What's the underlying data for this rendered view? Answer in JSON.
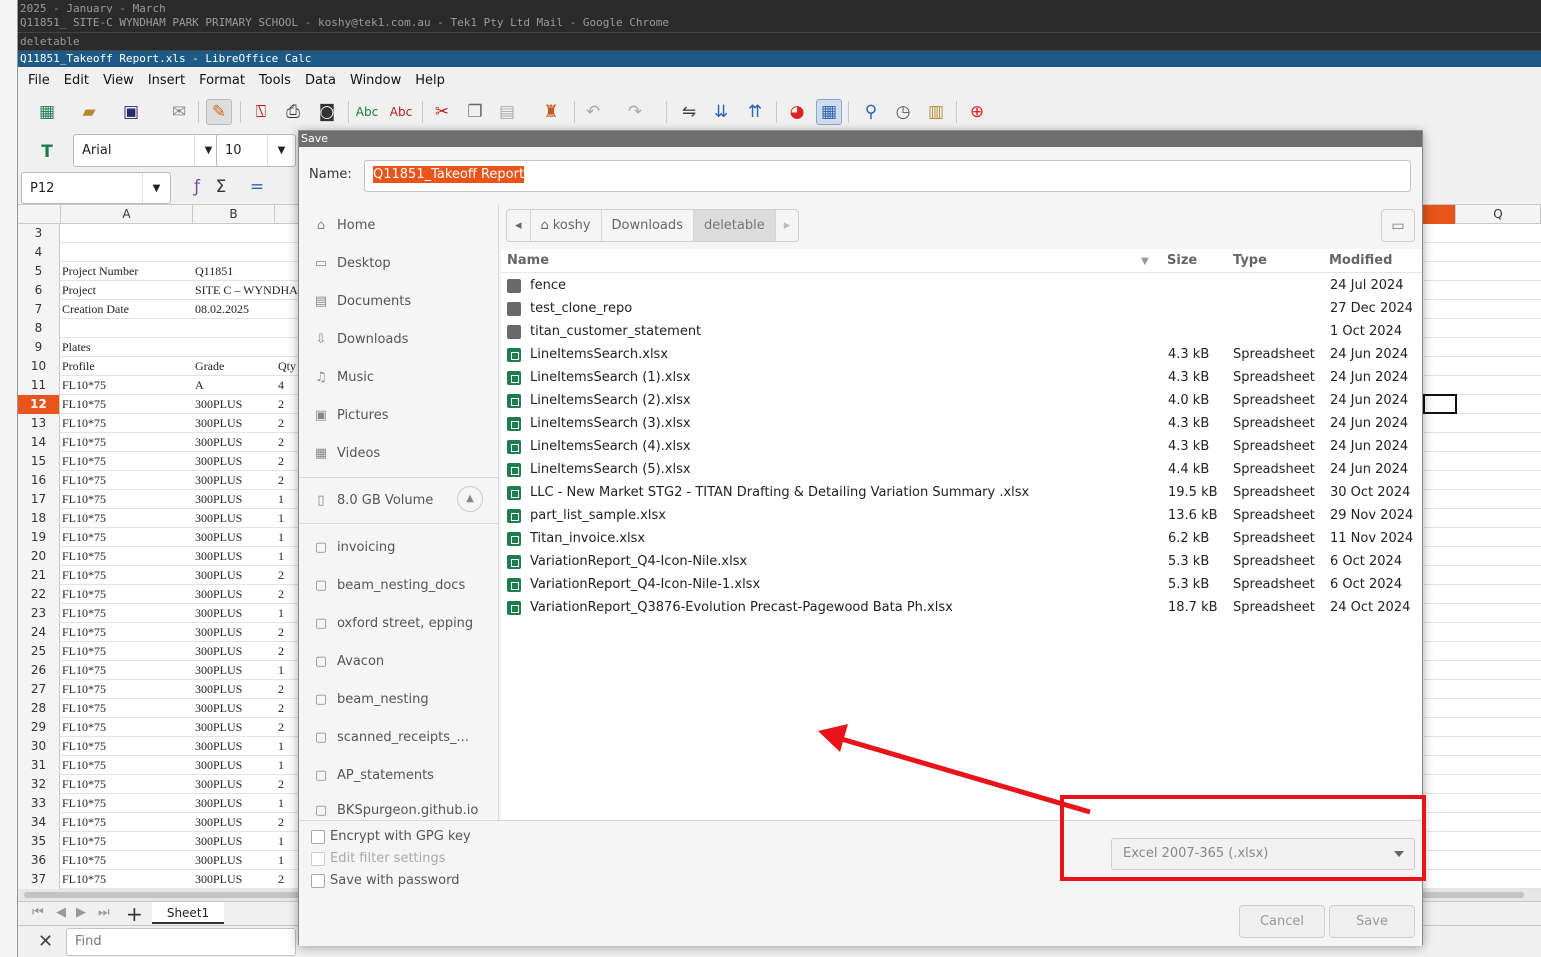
{
  "top_bars": [
    "2025 - January - March",
    "Q11851_ SITE-C WYNDHAM PARK PRIMARY SCHOOL - koshy@tek1.com.au - Tek1 Pty Ltd Mail - Google Chrome",
    "deletable"
  ],
  "window_title": "Q11851_Takeoff Report.xls - LibreOffice Calc",
  "menu": [
    "File",
    "Edit",
    "View",
    "Insert",
    "Format",
    "Tools",
    "Data",
    "Window",
    "Help"
  ],
  "toolbar": {
    "font_name": "Arial",
    "font_size": "10",
    "cell_ref": "P12"
  },
  "columns": [
    "A",
    "B",
    "Q"
  ],
  "sheet": {
    "rows": [
      {
        "n": "3",
        "a": "",
        "b": "",
        "c": ""
      },
      {
        "n": "4",
        "a": "",
        "b": "",
        "c": ""
      },
      {
        "n": "5",
        "a": "Project Number",
        "b": "Q11851",
        "c": ""
      },
      {
        "n": "6",
        "a": "Project",
        "b": "SITE C – WYNDHA",
        "c": ""
      },
      {
        "n": "7",
        "a": "Creation Date",
        "b": "08.02.2025",
        "c": ""
      },
      {
        "n": "8",
        "a": "",
        "b": "",
        "c": ""
      },
      {
        "n": "9",
        "a": "Plates",
        "b": "",
        "c": ""
      },
      {
        "n": "10",
        "a": "Profile",
        "b": "Grade",
        "c": "Qty"
      },
      {
        "n": "11",
        "a": "FL10*75",
        "b": "A",
        "c": "4"
      },
      {
        "n": "12",
        "a": "FL10*75",
        "b": "300PLUS",
        "c": "2"
      },
      {
        "n": "13",
        "a": "FL10*75",
        "b": "300PLUS",
        "c": "2"
      },
      {
        "n": "14",
        "a": "FL10*75",
        "b": "300PLUS",
        "c": "2"
      },
      {
        "n": "15",
        "a": "FL10*75",
        "b": "300PLUS",
        "c": "2"
      },
      {
        "n": "16",
        "a": "FL10*75",
        "b": "300PLUS",
        "c": "2"
      },
      {
        "n": "17",
        "a": "FL10*75",
        "b": "300PLUS",
        "c": "1"
      },
      {
        "n": "18",
        "a": "FL10*75",
        "b": "300PLUS",
        "c": "1"
      },
      {
        "n": "19",
        "a": "FL10*75",
        "b": "300PLUS",
        "c": "1"
      },
      {
        "n": "20",
        "a": "FL10*75",
        "b": "300PLUS",
        "c": "1"
      },
      {
        "n": "21",
        "a": "FL10*75",
        "b": "300PLUS",
        "c": "2"
      },
      {
        "n": "22",
        "a": "FL10*75",
        "b": "300PLUS",
        "c": "2"
      },
      {
        "n": "23",
        "a": "FL10*75",
        "b": "300PLUS",
        "c": "1"
      },
      {
        "n": "24",
        "a": "FL10*75",
        "b": "300PLUS",
        "c": "2"
      },
      {
        "n": "25",
        "a": "FL10*75",
        "b": "300PLUS",
        "c": "2"
      },
      {
        "n": "26",
        "a": "FL10*75",
        "b": "300PLUS",
        "c": "1"
      },
      {
        "n": "27",
        "a": "FL10*75",
        "b": "300PLUS",
        "c": "2"
      },
      {
        "n": "28",
        "a": "FL10*75",
        "b": "300PLUS",
        "c": "2"
      },
      {
        "n": "29",
        "a": "FL10*75",
        "b": "300PLUS",
        "c": "2"
      },
      {
        "n": "30",
        "a": "FL10*75",
        "b": "300PLUS",
        "c": "1"
      },
      {
        "n": "31",
        "a": "FL10*75",
        "b": "300PLUS",
        "c": "1"
      },
      {
        "n": "32",
        "a": "FL10*75",
        "b": "300PLUS",
        "c": "2"
      },
      {
        "n": "33",
        "a": "FL10*75",
        "b": "300PLUS",
        "c": "1"
      },
      {
        "n": "34",
        "a": "FL10*75",
        "b": "300PLUS",
        "c": "2"
      },
      {
        "n": "35",
        "a": "FL10*75",
        "b": "300PLUS",
        "c": "1"
      },
      {
        "n": "36",
        "a": "FL10*75",
        "b": "300PLUS",
        "c": "1"
      },
      {
        "n": "37",
        "a": "FL10*75",
        "b": "300PLUS",
        "c": "2"
      }
    ],
    "selected_row": "12",
    "tab": "Sheet1",
    "find_placeholder": "Find"
  },
  "dialog": {
    "title": "Save",
    "name_label": "Name:",
    "name_value": "Q11851_Takeoff Report",
    "places": [
      "Home",
      "Desktop",
      "Documents",
      "Downloads",
      "Music",
      "Pictures",
      "Videos"
    ],
    "volume": "8.0 GB Volume",
    "bookmarks": [
      "invoicing",
      "beam_nesting_docs",
      "oxford street, epping",
      "Avacon",
      "beam_nesting",
      "scanned_receipts_...",
      "AP_statements",
      "BKSpurgeon.github.io"
    ],
    "path": [
      "koshy",
      "Downloads",
      "deletable"
    ],
    "headers": {
      "name": "Name",
      "size": "Size",
      "type": "Type",
      "modified": "Modified"
    },
    "files": [
      {
        "name": "fence",
        "size": "",
        "type": "",
        "modified": "24 Jul 2024",
        "kind": "folder"
      },
      {
        "name": "test_clone_repo",
        "size": "",
        "type": "",
        "modified": "27 Dec 2024",
        "kind": "folder"
      },
      {
        "name": "titan_customer_statement",
        "size": "",
        "type": "",
        "modified": "1 Oct 2024",
        "kind": "folder"
      },
      {
        "name": "LineItemsSearch.xlsx",
        "size": "4.3 kB",
        "type": "Spreadsheet",
        "modified": "24 Jun 2024",
        "kind": "sheet"
      },
      {
        "name": "LineItemsSearch (1).xlsx",
        "size": "4.3 kB",
        "type": "Spreadsheet",
        "modified": "24 Jun 2024",
        "kind": "sheet"
      },
      {
        "name": "LineItemsSearch (2).xlsx",
        "size": "4.0 kB",
        "type": "Spreadsheet",
        "modified": "24 Jun 2024",
        "kind": "sheet"
      },
      {
        "name": "LineItemsSearch (3).xlsx",
        "size": "4.3 kB",
        "type": "Spreadsheet",
        "modified": "24 Jun 2024",
        "kind": "sheet"
      },
      {
        "name": "LineItemsSearch (4).xlsx",
        "size": "4.3 kB",
        "type": "Spreadsheet",
        "modified": "24 Jun 2024",
        "kind": "sheet"
      },
      {
        "name": "LineItemsSearch (5).xlsx",
        "size": "4.4 kB",
        "type": "Spreadsheet",
        "modified": "24 Jun 2024",
        "kind": "sheet"
      },
      {
        "name": "LLC - New Market STG2 - TITAN Drafting & Detailing Variation Summary .xlsx",
        "size": "19.5 kB",
        "type": "Spreadsheet",
        "modified": "30 Oct 2024",
        "kind": "sheet"
      },
      {
        "name": "part_list_sample.xlsx",
        "size": "13.6 kB",
        "type": "Spreadsheet",
        "modified": "29 Nov 2024",
        "kind": "sheet"
      },
      {
        "name": "Titan_invoice.xlsx",
        "size": "6.2 kB",
        "type": "Spreadsheet",
        "modified": "11 Nov 2024",
        "kind": "sheet"
      },
      {
        "name": "VariationReport_Q4-Icon-Nile.xlsx",
        "size": "5.3 kB",
        "type": "Spreadsheet",
        "modified": "6 Oct 2024",
        "kind": "sheet"
      },
      {
        "name": "VariationReport_Q4-Icon-Nile-1.xlsx",
        "size": "5.3 kB",
        "type": "Spreadsheet",
        "modified": "6 Oct 2024",
        "kind": "sheet"
      },
      {
        "name": "VariationReport_Q3876-Evolution Precast-Pagewood Bata Ph.xlsx",
        "size": "18.7 kB",
        "type": "Spreadsheet",
        "modified": "24 Oct 2024",
        "kind": "sheet"
      }
    ],
    "options": {
      "gpg": "Encrypt with GPG key",
      "filter": "Edit filter settings",
      "password": "Save with password"
    },
    "file_type": "Excel 2007-365 (.xlsx)",
    "cancel": "Cancel",
    "save": "Save"
  },
  "annotation_color": "#e8141a",
  "selection_color": "#e8541a"
}
